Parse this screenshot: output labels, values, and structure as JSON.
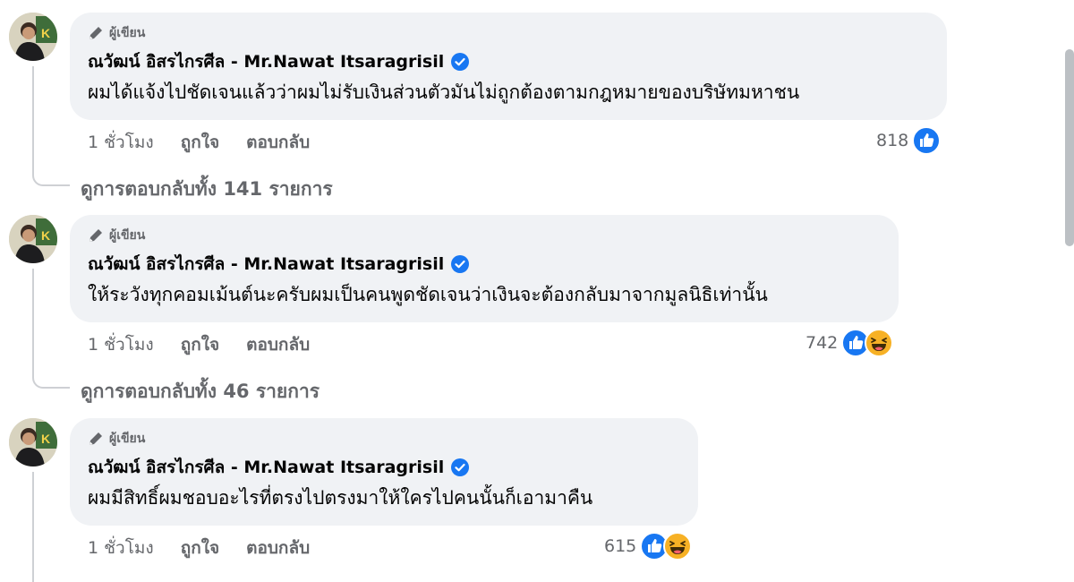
{
  "comments": [
    {
      "badge": "ผู้เขียน",
      "name": "ณวัฒน์ อิสรไกรศีล - Mr.Nawat Itsaragrisil",
      "text": "ผมได้แจ้งไปชัดเจนแล้วว่าผมไม่รับเงินส่วนตัวมันไม่ถูกต้องตามกฎหมายของบริษัทมหาชน",
      "time": "1 ชั่วโมง",
      "like_label": "ถูกใจ",
      "reply_label": "ตอบกลับ",
      "reaction_count": "818",
      "reactions": [
        "like"
      ],
      "view_replies": "ดูการตอบกลับทั้ง 141 รายการ"
    },
    {
      "badge": "ผู้เขียน",
      "name": "ณวัฒน์ อิสรไกรศีล - Mr.Nawat Itsaragrisil",
      "text": "ให้ระวังทุกคอมเม้นต์นะครับผมเป็นคนพูดชัดเจนว่าเงินจะต้องกลับมาจากมูลนิธิเท่านั้น",
      "time": "1 ชั่วโมง",
      "like_label": "ถูกใจ",
      "reply_label": "ตอบกลับ",
      "reaction_count": "742",
      "reactions": [
        "like",
        "haha"
      ],
      "view_replies": "ดูการตอบกลับทั้ง 46 รายการ"
    },
    {
      "badge": "ผู้เขียน",
      "name": "ณวัฒน์ อิสรไกรศีล - Mr.Nawat Itsaragrisil",
      "text": "ผมมีสิทธิ์ผมชอบอะไรที่ตรงไปตรงมาให้ใครไปคนนั้นก็เอามาคืน",
      "time": "1 ชั่วโมง",
      "like_label": "ถูกใจ",
      "reply_label": "ตอบกลับ",
      "reaction_count": "615",
      "reactions": [
        "like",
        "haha"
      ]
    }
  ],
  "icons": {
    "badge": "pencil-icon",
    "verified": "verified-badge-icon",
    "like": "like-reaction-icon",
    "haha": "haha-reaction-icon"
  },
  "colors": {
    "bubble": "#f0f2f5",
    "secondary_text": "#65676b",
    "like_blue": "#1877f2",
    "verified_blue": "#1877f2",
    "haha_yellow": "#f7b125"
  }
}
